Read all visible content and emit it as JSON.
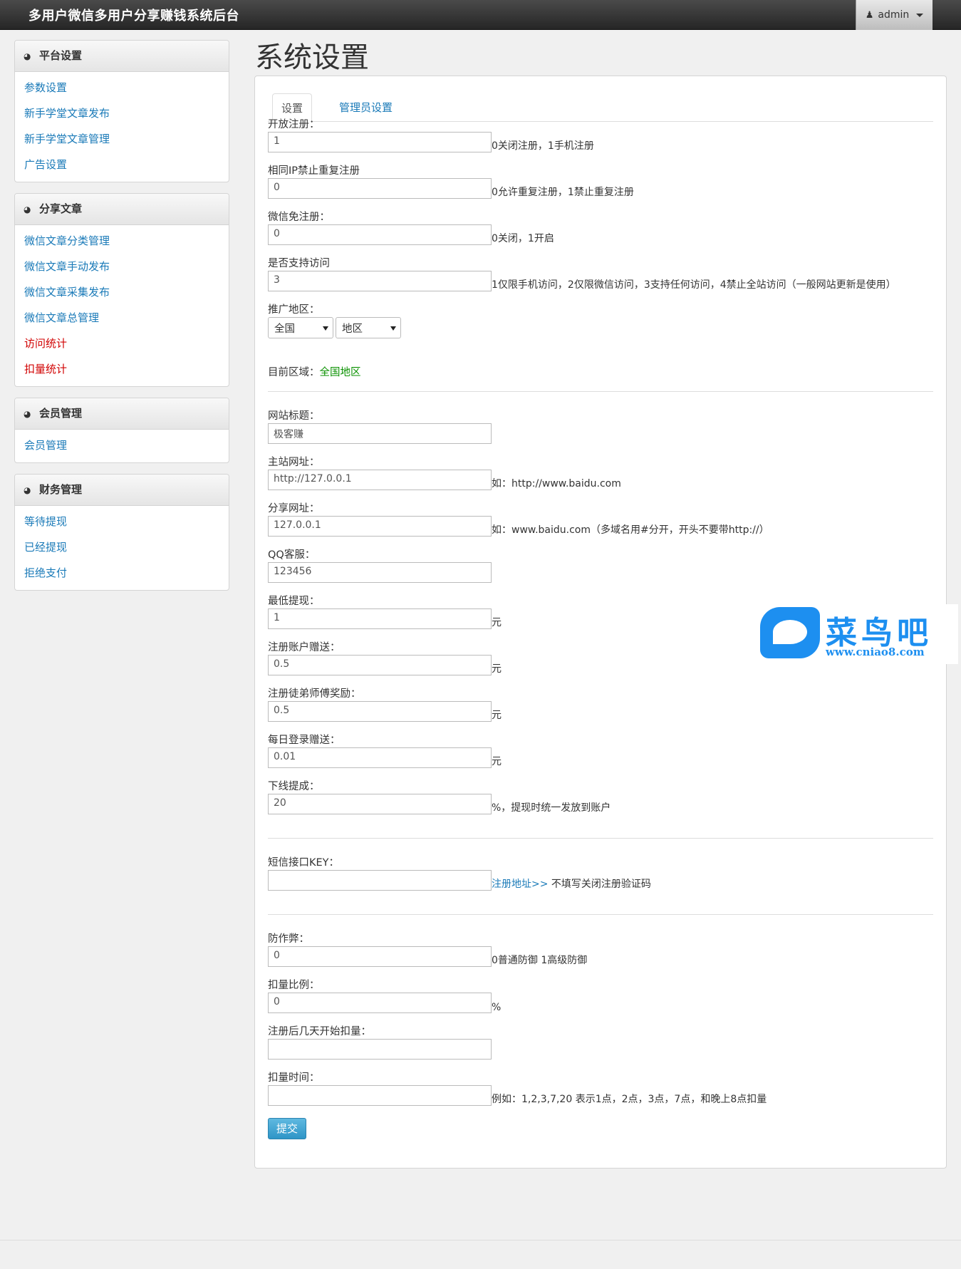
{
  "header": {
    "brand": "多用户微信多用户分享赚钱系统后台",
    "user": "admin"
  },
  "sidebar": [
    {
      "title": "平台设置",
      "items": [
        {
          "label": "参数设置",
          "color": "blue"
        },
        {
          "label": "新手学堂文章发布",
          "color": "blue"
        },
        {
          "label": "新手学堂文章管理",
          "color": "blue"
        },
        {
          "label": "广告设置",
          "color": "blue"
        }
      ]
    },
    {
      "title": "分享文章",
      "items": [
        {
          "label": "微信文章分类管理",
          "color": "blue"
        },
        {
          "label": "微信文章手动发布",
          "color": "blue"
        },
        {
          "label": "微信文章采集发布",
          "color": "blue"
        },
        {
          "label": "微信文章总管理",
          "color": "blue"
        },
        {
          "label": "访问统计",
          "color": "red"
        },
        {
          "label": "扣量统计",
          "color": "red"
        }
      ]
    },
    {
      "title": "会员管理",
      "items": [
        {
          "label": "会员管理",
          "color": "blue"
        }
      ]
    },
    {
      "title": "财务管理",
      "items": [
        {
          "label": "等待提现",
          "color": "blue"
        },
        {
          "label": "已经提现",
          "color": "blue"
        },
        {
          "label": "拒绝支付",
          "color": "blue"
        }
      ]
    }
  ],
  "main": {
    "title": "系统设置",
    "tabs": [
      "设置",
      "管理员设置"
    ],
    "fields": {
      "open_reg": {
        "label": "开放注册：",
        "value": "1",
        "hint": "0关闭注册，1手机注册"
      },
      "same_ip": {
        "label": "相同IP禁止重复注册",
        "value": "0",
        "hint": "0允许重复注册，1禁止重复注册"
      },
      "wechat_free": {
        "label": "微信免注册：",
        "value": "0",
        "hint": "0关闭，1开启"
      },
      "access": {
        "label": "是否支持访问",
        "value": "3",
        "hint": "1仅限手机访问，2仅限微信访问，3支持任何访问，4禁止全站访问（一般网站更新是使用）"
      },
      "region": {
        "label": "推广地区：",
        "select1": "全国",
        "select2": "地区",
        "current_label": "目前区域：",
        "current_value": "全国地区"
      },
      "site_title": {
        "label": "网站标题：",
        "value": "极客赚"
      },
      "main_url": {
        "label": "主站网址：",
        "value": "http://127.0.0.1",
        "hint": "如：http://www.baidu.com"
      },
      "share_url": {
        "label": "分享网址：",
        "value": "127.0.0.1",
        "hint": "如：www.baidu.com（多域名用#分开，开头不要带http://）"
      },
      "qq": {
        "label": "QQ客服：",
        "value": "123456"
      },
      "min_withdraw": {
        "label": "最低提现：",
        "value": "1",
        "hint": "元"
      },
      "reg_gift": {
        "label": "注册账户赠送：",
        "value": "0.5",
        "hint": "元"
      },
      "apprentice": {
        "label": "注册徒弟师傅奖励：",
        "value": "0.5",
        "hint": "元"
      },
      "daily_login": {
        "label": "每日登录赠送：",
        "value": "0.01",
        "hint": "元"
      },
      "commission": {
        "label": "下线提成：",
        "value": "20",
        "hint": "%，提现时统一发放到账户"
      },
      "sms_key": {
        "label": "短信接口KEY：",
        "value": "",
        "link": "注册地址>>",
        "hint": " 不填写关闭注册验证码"
      },
      "anti_cheat": {
        "label": "防作弊：",
        "value": "0",
        "hint": "0普通防御 1高级防御"
      },
      "deduct_ratio": {
        "label": "扣量比例：",
        "value": "0",
        "hint": "%"
      },
      "deduct_days": {
        "label": "注册后几天开始扣量：",
        "value": ""
      },
      "deduct_time": {
        "label": "扣量时间：",
        "value": "",
        "hint": "例如：1,2,3,7,20 表示1点，2点，3点，7点，和晚上8点扣量"
      }
    },
    "submit": "提交"
  },
  "watermark": {
    "text": "菜鸟吧",
    "url": "www.cniao8.com"
  }
}
